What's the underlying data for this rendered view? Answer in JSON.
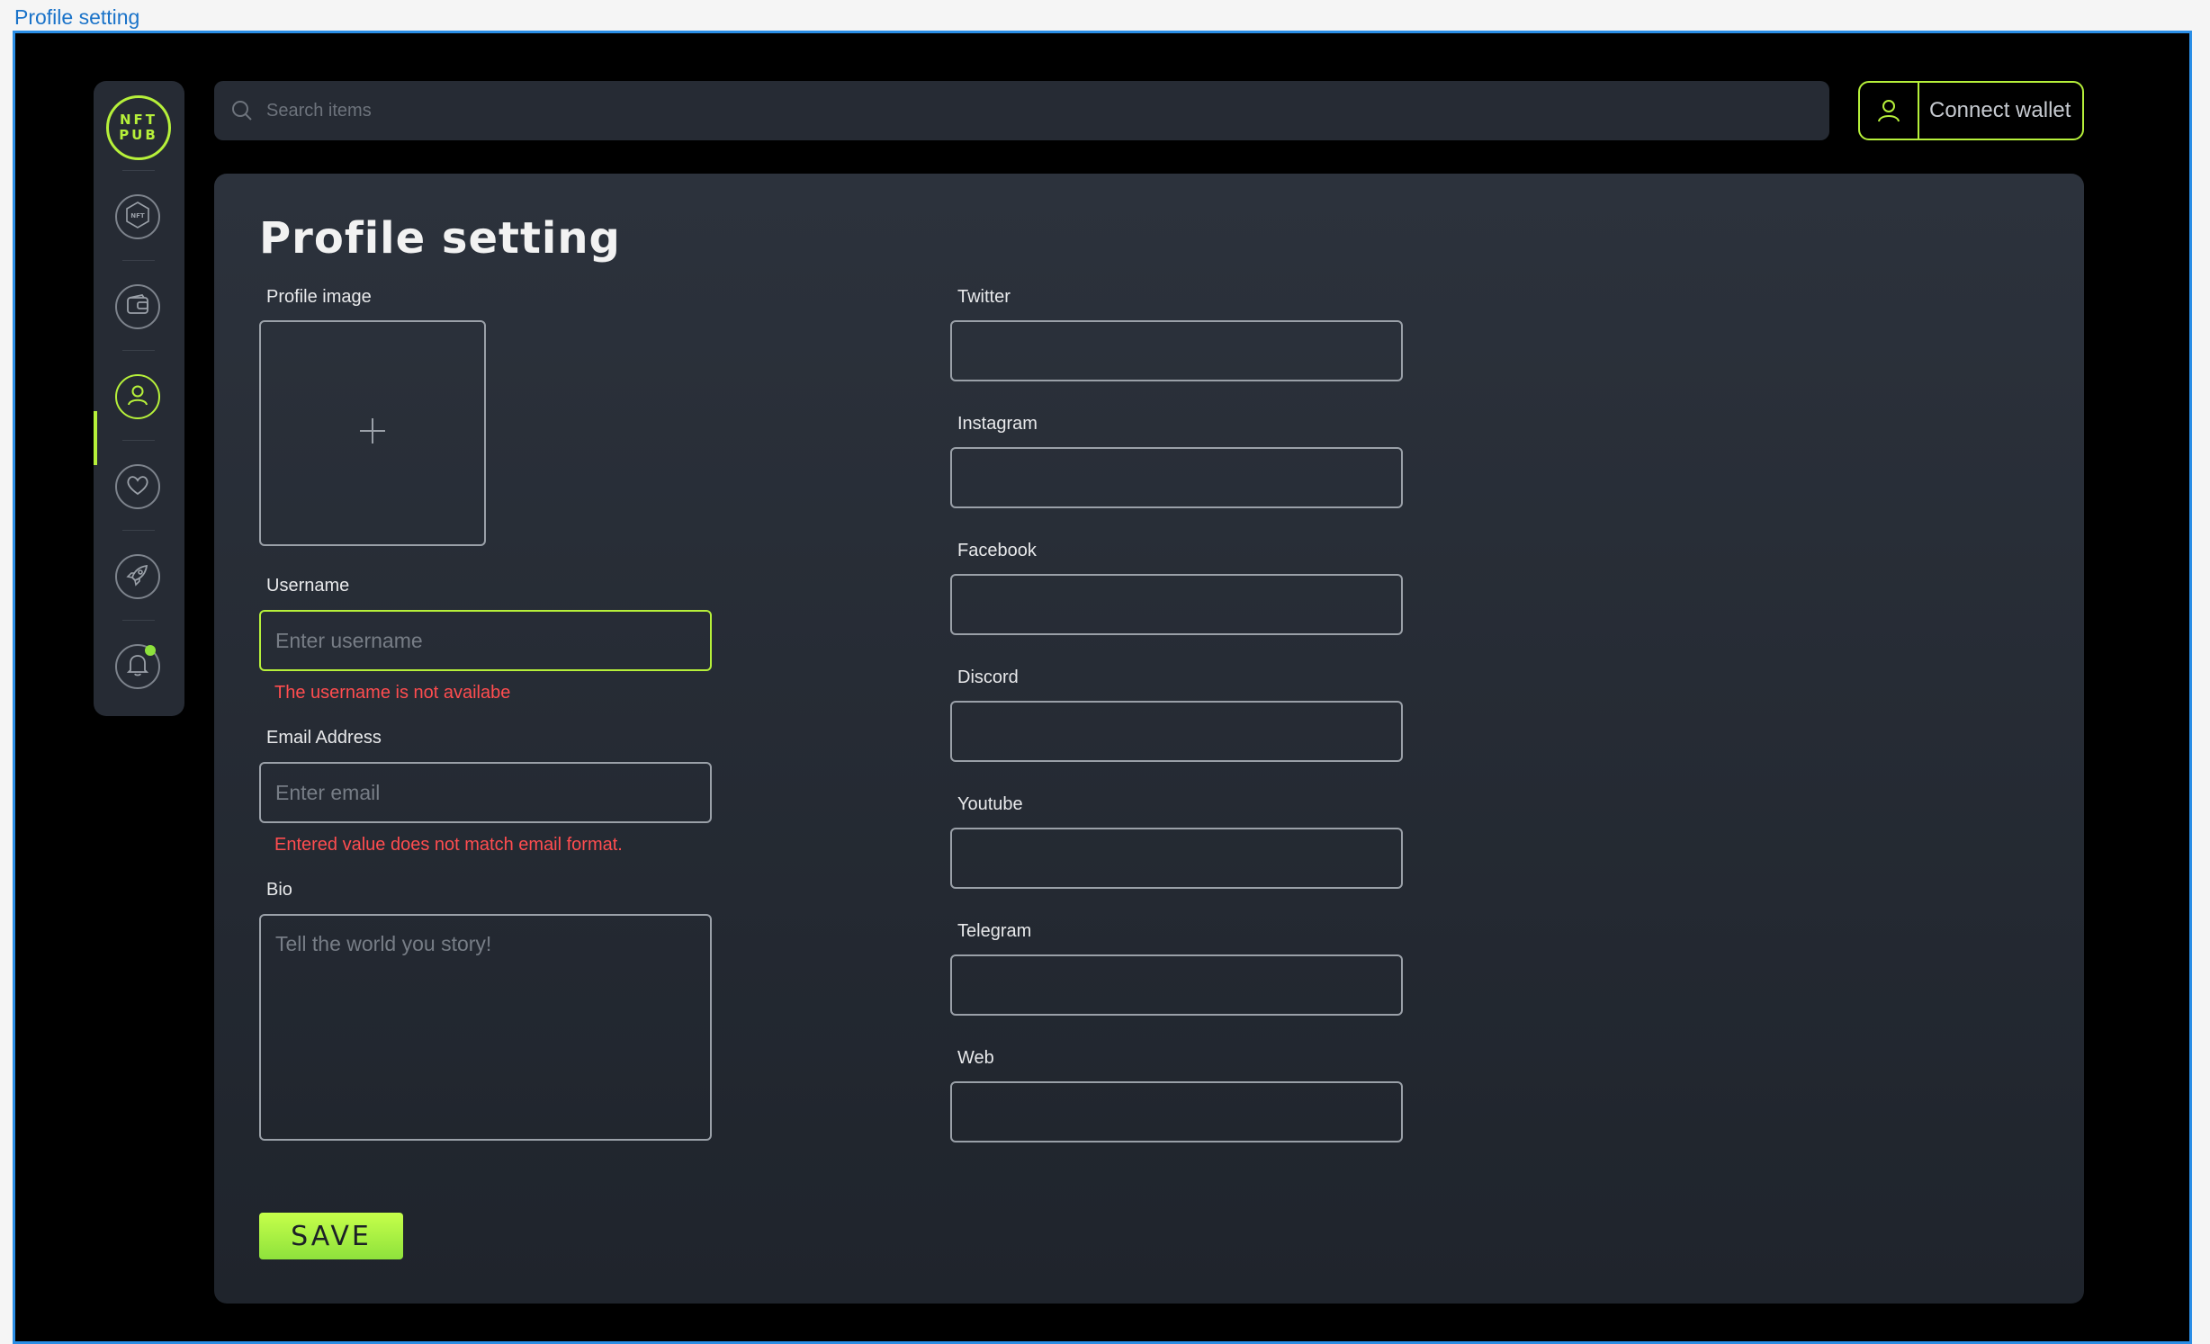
{
  "frame": {
    "label": "Profile setting"
  },
  "sidebar": {
    "logo_line1": "NFT",
    "logo_line2": "PUB",
    "items": [
      {
        "name": "nft",
        "icon": "nft-hexagon-icon",
        "label": "NFT",
        "active": false
      },
      {
        "name": "wallet",
        "icon": "wallet-icon",
        "active": false
      },
      {
        "name": "profile",
        "icon": "user-icon",
        "active": true
      },
      {
        "name": "favorites",
        "icon": "heart-icon",
        "active": false
      },
      {
        "name": "launch",
        "icon": "rocket-icon",
        "active": false
      },
      {
        "name": "notifications",
        "icon": "bell-icon",
        "active": false,
        "has_badge": true
      }
    ]
  },
  "search": {
    "placeholder": "Search items",
    "icon": "search-icon"
  },
  "wallet": {
    "label": "Connect wallet",
    "icon": "user-icon"
  },
  "form": {
    "title": "Profile setting",
    "profile_image_label": "Profile image",
    "upload_icon": "plus-icon",
    "username": {
      "label": "Username",
      "placeholder": "Enter username",
      "value": "",
      "error": "The username is not availabe"
    },
    "email": {
      "label": "Email Address",
      "placeholder": "Enter email",
      "value": "",
      "error": "Entered value does not match email format."
    },
    "bio": {
      "label": "Bio",
      "placeholder": "Tell the world you story!",
      "value": ""
    },
    "socials": [
      {
        "label": "Twitter",
        "value": ""
      },
      {
        "label": "Instagram",
        "value": ""
      },
      {
        "label": "Facebook",
        "value": ""
      },
      {
        "label": "Discord",
        "value": ""
      },
      {
        "label": "Youtube",
        "value": ""
      },
      {
        "label": "Telegram",
        "value": ""
      },
      {
        "label": "Web",
        "value": ""
      }
    ],
    "save_label": "SAVE"
  },
  "colors": {
    "accent": "#b6f03a",
    "error": "#ff4d4f",
    "panel": "#2c323c",
    "frame_border": "#2a8ee6"
  }
}
